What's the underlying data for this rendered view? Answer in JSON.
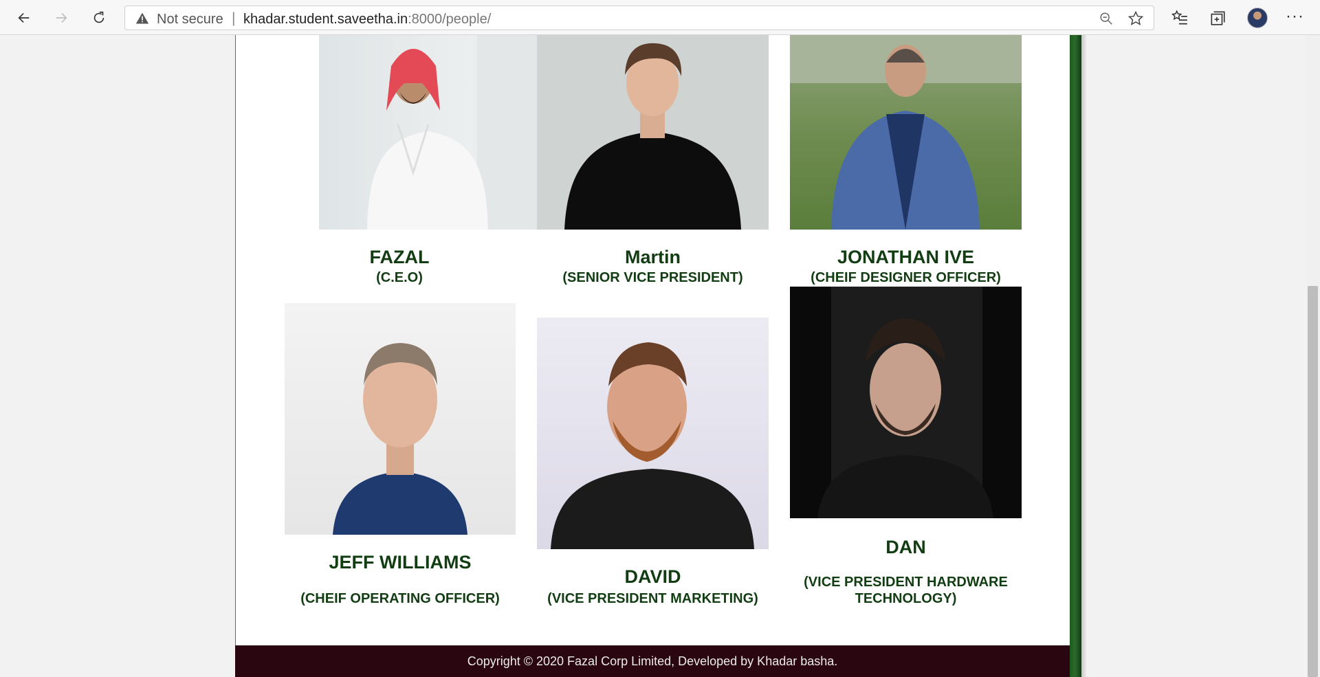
{
  "browser": {
    "security_label": "Not secure",
    "url_host": "khadar.student.saveetha.in",
    "url_port_path": ":8000/people/",
    "icons": [
      "back-icon",
      "forward-icon",
      "refresh-icon",
      "warning-icon",
      "zoom-icon",
      "favorite-star-icon",
      "favorites-list-icon",
      "collections-icon",
      "profile-avatar",
      "more-icon"
    ]
  },
  "people": [
    {
      "name": "FAZAL",
      "role": "(C.E.O)"
    },
    {
      "name": "Martin",
      "role": "(SENIOR VICE PRESIDENT)"
    },
    {
      "name": "JONATHAN IVE",
      "role": "(CHEIF DESIGNER OFFICER)"
    },
    {
      "name": "JEFF WILLIAMS",
      "role": "(CHEIF OPERATING OFFICER)"
    },
    {
      "name": "DAVID",
      "role": "(VICE PRESIDENT MARKETING)"
    },
    {
      "name": "DAN",
      "role": "(VICE PRESIDENT HARDWARE TECHNOLOGY)"
    }
  ],
  "footer": {
    "text": "Copyright © 2020 Fazal Corp Limited, Developed by Khadar basha."
  },
  "colors": {
    "heading": "#123c12",
    "footer_bg": "#2a0710",
    "side_bar": "#1d5a1d"
  }
}
